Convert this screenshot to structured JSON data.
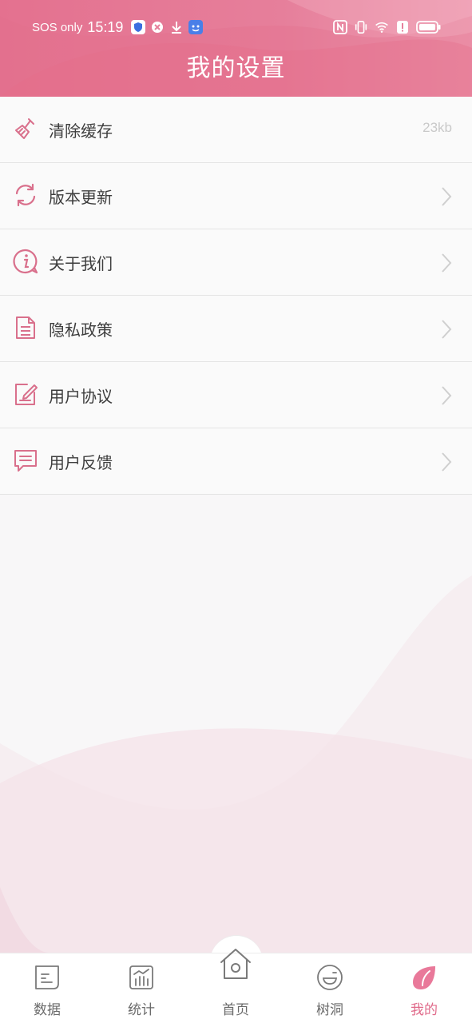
{
  "status_bar": {
    "carrier": "SOS only",
    "time": "15:19",
    "icons": [
      "shield-icon",
      "close-circle-icon",
      "download-icon",
      "app-icon",
      "nfc-icon",
      "vibrate-icon",
      "wifi-icon",
      "alert-icon",
      "battery-icon"
    ]
  },
  "header": {
    "title": "我的设置",
    "color": "#e67f9b"
  },
  "menu": {
    "items": [
      {
        "label": "清除缓存",
        "value": "23kb",
        "icon": "broom-icon"
      },
      {
        "label": "版本更新",
        "icon": "refresh-icon"
      },
      {
        "label": "关于我们",
        "icon": "info-icon"
      },
      {
        "label": "隐私政策",
        "icon": "document-icon"
      },
      {
        "label": "用户协议",
        "icon": "edit-document-icon"
      },
      {
        "label": "用户反馈",
        "icon": "feedback-icon"
      }
    ]
  },
  "bottom_nav": {
    "items": [
      {
        "label": "数据",
        "icon": "data-icon"
      },
      {
        "label": "统计",
        "icon": "chart-icon"
      },
      {
        "label": "首页",
        "icon": "home-icon"
      },
      {
        "label": "树洞",
        "icon": "smile-icon"
      },
      {
        "label": "我的",
        "icon": "leaf-icon",
        "active": true
      }
    ],
    "active_color": "#e06a8a"
  }
}
